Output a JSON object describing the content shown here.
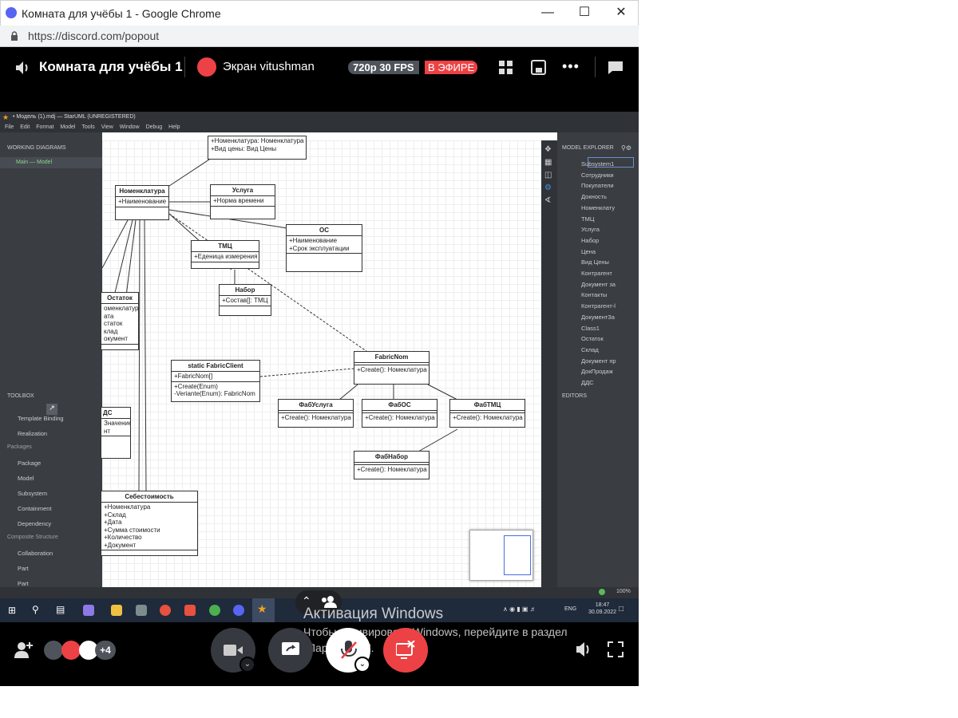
{
  "window": {
    "title": "Комната для учёбы 1 - Google Chrome",
    "url": "https://discord.com/popout"
  },
  "header": {
    "room": "Комната для учёбы 1",
    "stream": "Экран vitushman",
    "quality": "720p 30 FPS",
    "live": "В ЭФИРЕ"
  },
  "staruml": {
    "title": "• Модель (1).mdj — StarUML (UNREGISTERED)",
    "menu": [
      "File",
      "Edit",
      "Format",
      "Model",
      "Tools",
      "View",
      "Window",
      "Debug",
      "Help"
    ],
    "working_diagrams": "WORKING DIAGRAMS",
    "diagram_item": "Main — Model",
    "toolbox": "TOOLBOX",
    "tool_items": [
      "Template Binding",
      "Realization"
    ],
    "packages_header": "Packages",
    "package_items": [
      "Package",
      "Model",
      "Subsystem",
      "Containment",
      "Dependency"
    ],
    "composite_header": "Composite Structure",
    "composite_items": [
      "Collaboration",
      "Part",
      "Part"
    ],
    "model_explorer": "MODEL EXPLORER",
    "explorer_items": [
      "Subsystem1",
      "Сотрудники",
      "Покупатели",
      "Докность",
      "Номенклату",
      "ТМЦ",
      "Услуга",
      "Набор",
      "Цена",
      "Вид Цены",
      "Контрагент",
      "Документ за",
      "Контакты",
      "Контрагент-l",
      "ДокументЗа",
      "Class1",
      "Остаток",
      "Склад",
      "Документ пр",
      "ДокПродаж",
      "ДДС"
    ],
    "editors": "EDITORS",
    "zoom": "100%",
    "classes": {
      "top": {
        "attrs": [
          "+Номенклатура: Номенклатура",
          "+Вид цены: Вид Цены"
        ]
      },
      "nomenklatura": {
        "name": "Номенклатура",
        "attrs": [
          "+Наименование"
        ]
      },
      "usluga": {
        "name": "Услуга",
        "attrs": [
          "+Норма времени"
        ]
      },
      "os": {
        "name": "ОС",
        "attrs": [
          "+Наименование",
          "+Срок эксплуатации"
        ]
      },
      "tmc": {
        "name": "ТМЦ",
        "attrs": [
          "+Еденица измерения"
        ]
      },
      "nabor": {
        "name": "Набор",
        "attrs": [
          "+Состав[]: ТМЦ"
        ]
      },
      "ostatok": {
        "name": "Остаток",
        "attrs": [
          "оменклатура",
          "ата",
          "статок",
          "клад",
          "окумент"
        ]
      },
      "fabricclient": {
        "name": "static FabricClient",
        "attrs": [
          "+FabricNom[]"
        ],
        "ops": [
          "+Create(Enum)",
          "-Veriante(Enum): FabricNom"
        ]
      },
      "fabricnom": {
        "name": "FabricNom",
        "ops": [
          "+Create(): Номеклатура"
        ]
      },
      "fabusluga": {
        "name": "ФабУслуга",
        "ops": [
          "+Create(): Номеклатура"
        ]
      },
      "fabos": {
        "name": "ФабОС",
        "ops": [
          "+Create(): Номеклатура"
        ]
      },
      "fabtmc": {
        "name": "ФабТМЦ",
        "ops": [
          "+Create(): Номеклатура"
        ]
      },
      "fabnabor": {
        "name": "ФабНабор",
        "ops": [
          "+Create(): Номеклатура"
        ]
      },
      "dds": {
        "name": "ДС",
        "attrs": [
          "Значение",
          "",
          "нт"
        ]
      },
      "sebest": {
        "name": "Себестоимость",
        "attrs": [
          "+Номенклатура",
          "+Склад",
          "+Дата",
          "+Сумма стоимости",
          "+Количество",
          "+Документ"
        ]
      }
    },
    "taskbar": {
      "lang": "ENG",
      "time": "18:47",
      "date": "30.09.2022"
    }
  },
  "overlay": {
    "activation_title": "Активация Windows",
    "activation_text": "Чтобы активировать Windows, перейдите в раздел \"Параметры\"."
  },
  "bottom": {
    "extra_count": "+4"
  }
}
